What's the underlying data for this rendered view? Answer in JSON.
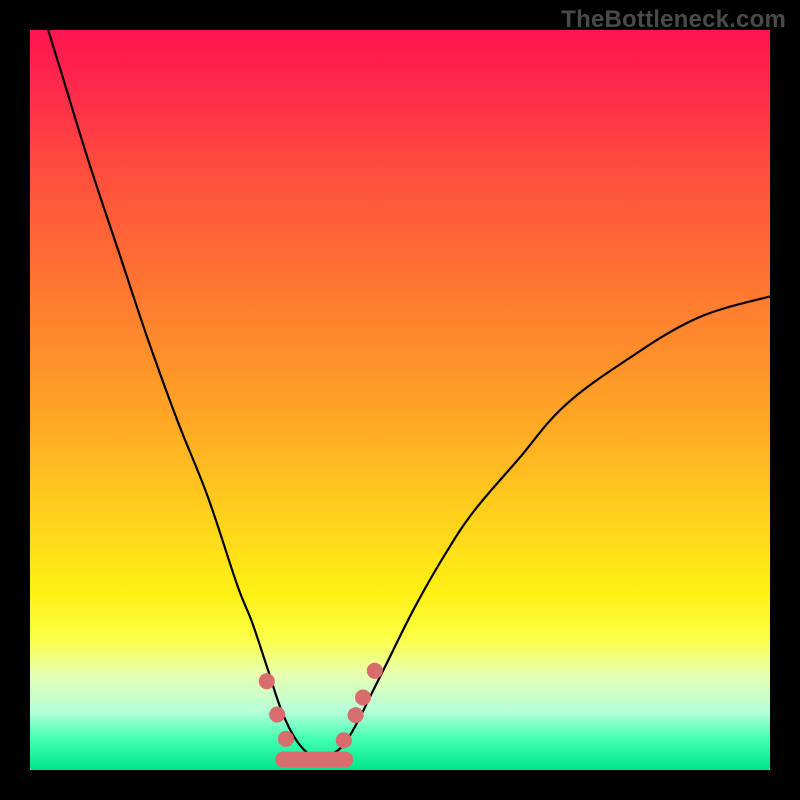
{
  "watermark": {
    "text": "TheBottleneck.com"
  },
  "icons": {},
  "chart_data": {
    "type": "line",
    "title": "",
    "xlabel": "",
    "ylabel": "",
    "xlim": [
      0,
      100
    ],
    "ylim": [
      0,
      100
    ],
    "note": "Values estimated from pixel positions; x spans plot width 0–100, y is height above bottom 0–100. Curve is a V-shaped bottleneck profile dipping to ~0 around x≈37.",
    "series": [
      {
        "name": "bottleneck-curve",
        "x": [
          0,
          4,
          8,
          12,
          16,
          20,
          24,
          28,
          30,
          32,
          34,
          36,
          38,
          40,
          42,
          44,
          46,
          48,
          52,
          56,
          60,
          66,
          72,
          80,
          90,
          100
        ],
        "y": [
          108,
          95,
          82,
          70,
          58,
          47,
          37,
          25,
          20,
          14,
          8,
          4,
          2,
          2,
          3,
          6,
          10,
          14,
          22,
          29,
          35,
          42,
          49,
          55,
          61,
          64
        ]
      }
    ],
    "markers": {
      "name": "highlight-points",
      "points": [
        {
          "x": 32.0,
          "y": 12.0
        },
        {
          "x": 33.4,
          "y": 7.5
        },
        {
          "x": 34.6,
          "y": 4.2
        },
        {
          "x": 42.4,
          "y": 4.0
        },
        {
          "x": 44.0,
          "y": 7.4
        },
        {
          "x": 45.0,
          "y": 9.8
        },
        {
          "x": 46.6,
          "y": 13.4
        }
      ]
    },
    "floor_segment": {
      "x0": 34.2,
      "x1": 42.6,
      "y": 1.4
    },
    "background_gradient": {
      "top": "#ff1450",
      "mid": "#ffd21c",
      "bottom": "#00e58b"
    }
  }
}
